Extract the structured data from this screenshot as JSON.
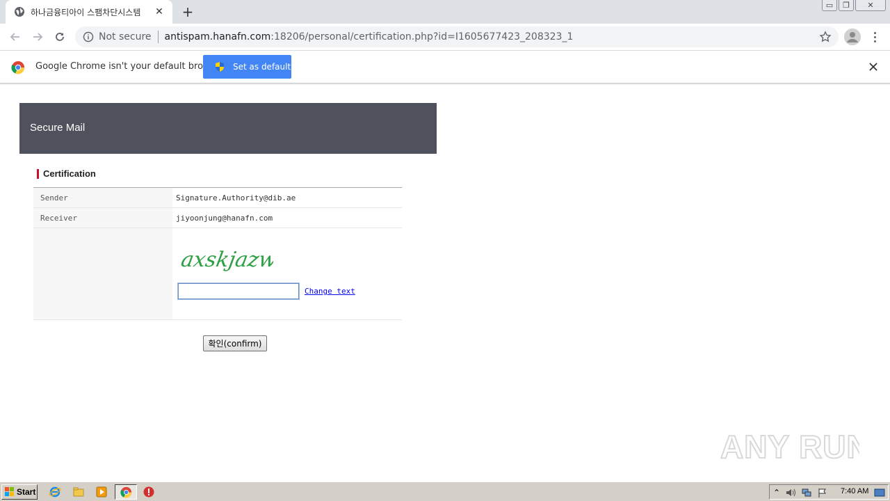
{
  "browser": {
    "tab": {
      "title": "하나금융티아이 스팸차단시스템"
    },
    "address": {
      "security_label": "Not secure",
      "host": "antispam.hanafn.com",
      "path": ":18206/personal/certification.php?id=I1605677423_208323_1"
    }
  },
  "infobar": {
    "message": "Google Chrome isn't your default browser",
    "button_label": "Set as default"
  },
  "page": {
    "header_title": "Secure Mail",
    "section_title": "Certification",
    "rows": [
      {
        "label": "Sender",
        "value": "Signature.Authority@dib.ae"
      },
      {
        "label": "Receiver",
        "value": "jiyoonjung@hanafn.com"
      }
    ],
    "captcha": {
      "text": "axskjazw",
      "input_value": "",
      "change_text_label": "Change text"
    },
    "confirm_label": "확인(confirm)"
  },
  "watermark": {
    "text": "ANY RUN"
  },
  "taskbar": {
    "start_label": "Start",
    "clock": "7:40 AM"
  }
}
